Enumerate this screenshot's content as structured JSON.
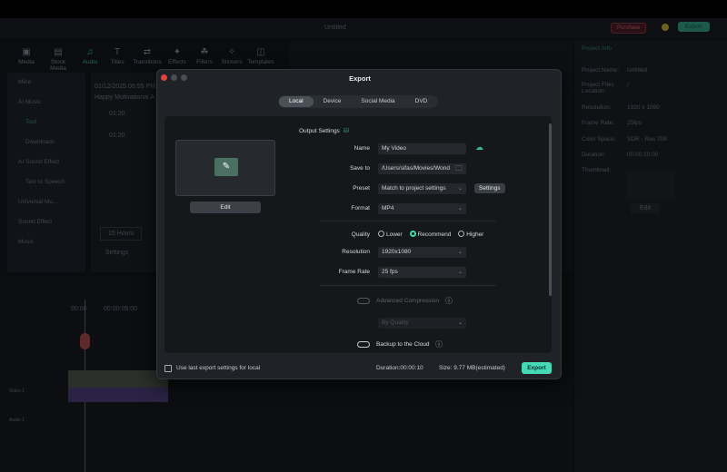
{
  "app": {
    "title": "Untitled",
    "purchase": "Purchase",
    "export": "Export"
  },
  "toolbar": [
    "Media",
    "Stock Media",
    "Audio",
    "Titles",
    "Transitions",
    "Effects",
    "Filters",
    "Stickers",
    "Templates"
  ],
  "sidebar": [
    "Mine",
    "AI Music",
    "Tool",
    "Downloads",
    "AI Sound Effect",
    "Text to Speech",
    "Universal Mu...",
    "Sound Effect",
    "Music"
  ],
  "content": {
    "date": "01/12/2025 06:55 PM",
    "title": "Happy Motivational A",
    "clips": [
      "01:20",
      "01:20"
    ],
    "filter": "15 Hours",
    "settings": "Settings"
  },
  "right_panel": {
    "tab": "Project Info",
    "rows": [
      {
        "k": "Project Name:",
        "v": "Untitled"
      },
      {
        "k": "Project Files Location:",
        "v": "/"
      },
      {
        "k": "Resolution:",
        "v": "1920 x 1080"
      },
      {
        "k": "Frame Rate:",
        "v": "25fps"
      },
      {
        "k": "Color Space:",
        "v": "SDR - Rec.709"
      },
      {
        "k": "Duration:",
        "v": "00:00:10:00"
      }
    ],
    "thumbnail": "Thumbnail:",
    "edit": "Edit"
  },
  "timeline": {
    "time_a": "00:00",
    "time_b": "00:00:05:00",
    "track_video": "Video 1",
    "track_audio": "Audio 1"
  },
  "export_dialog": {
    "title": "Export",
    "tabs": [
      "Local",
      "Device",
      "Social Media",
      "DVD"
    ],
    "active_tab": "Local",
    "edit_label": "Edit",
    "section": "Output Settings",
    "name_label": "Name",
    "name_value": "My Video",
    "save_label": "Save to",
    "save_value": "/Users/sifas/Movies/Wond",
    "preset_label": "Preset",
    "preset_value": "Match to project settings",
    "settings_button": "Settings",
    "format_label": "Format",
    "format_value": "MP4",
    "quality_label": "Quality",
    "quality_options": [
      "Lower",
      "Recommend",
      "Higher"
    ],
    "quality_selected": "Recommend",
    "resolution_label": "Resolution",
    "resolution_value": "1920x1080",
    "framerate_label": "Frame Rate",
    "framerate_value": "25 fps",
    "adv_label": "Advanced Compression",
    "adv_mode": "By Quality",
    "cloud_label": "Backup to the Cloud",
    "last_settings": "Use last export settings for local",
    "duration": "Duration:00:00:10",
    "size": "Size: 9.77 MB(estimated)",
    "export_button": "Export"
  }
}
